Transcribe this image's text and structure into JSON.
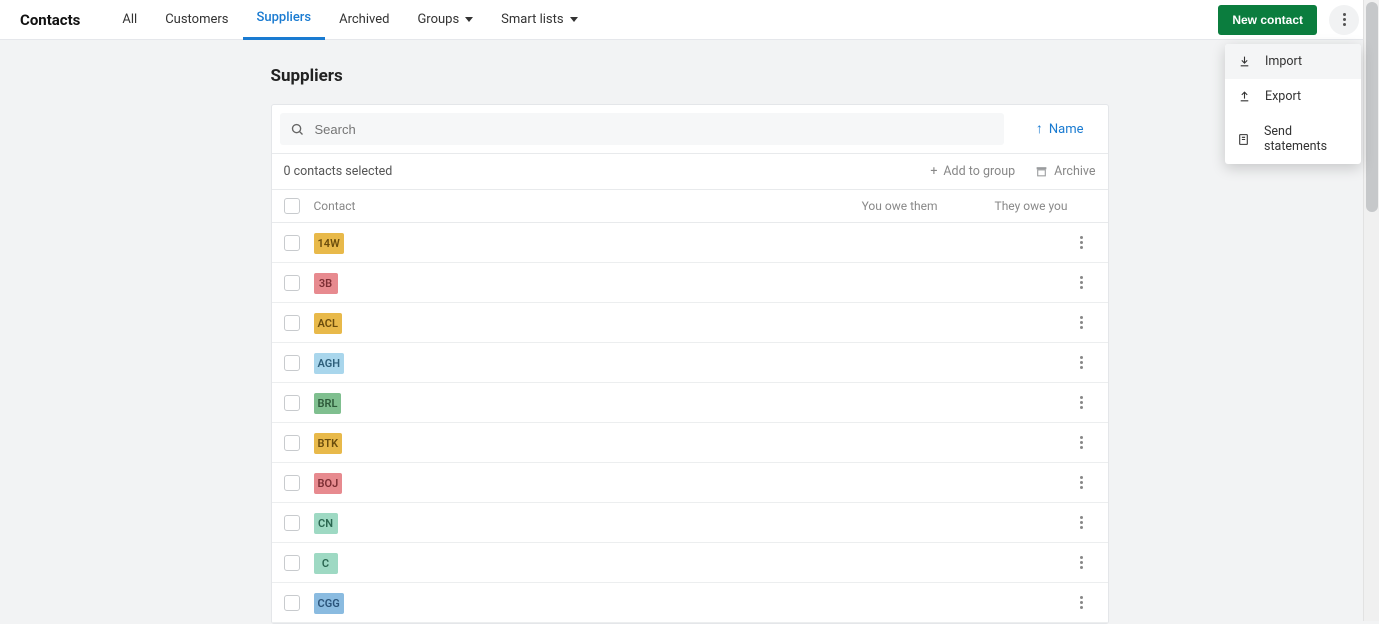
{
  "nav": {
    "title": "Contacts",
    "tabs": [
      {
        "label": "All",
        "active": false,
        "dropdown": false
      },
      {
        "label": "Customers",
        "active": false,
        "dropdown": false
      },
      {
        "label": "Suppliers",
        "active": true,
        "dropdown": false
      },
      {
        "label": "Archived",
        "active": false,
        "dropdown": false
      },
      {
        "label": "Groups",
        "active": false,
        "dropdown": true
      },
      {
        "label": "Smart lists",
        "active": false,
        "dropdown": true
      }
    ],
    "new_contact_label": "New contact"
  },
  "dropdown": {
    "items": [
      {
        "label": "Import",
        "icon": "import-icon"
      },
      {
        "label": "Export",
        "icon": "export-icon"
      },
      {
        "label": "Send statements",
        "icon": "statement-icon"
      }
    ]
  },
  "page_title": "Suppliers",
  "search": {
    "placeholder": "Search"
  },
  "sort": {
    "label": "Name",
    "direction": "asc"
  },
  "selection_text": "0 contacts selected",
  "actions": {
    "add_to_group": "Add to group",
    "archive": "Archive"
  },
  "columns": {
    "contact": "Contact",
    "you_owe": "You owe them",
    "they_owe": "They owe you"
  },
  "rows": [
    {
      "badge": "14W",
      "bg": "#e8b94a",
      "fg": "#6b4d0d"
    },
    {
      "badge": "3B",
      "bg": "#e78a8f",
      "fg": "#7d2e34"
    },
    {
      "badge": "ACL",
      "bg": "#e8b94a",
      "fg": "#6b4d0d"
    },
    {
      "badge": "AGH",
      "bg": "#a9d6ec",
      "fg": "#2e5f7a"
    },
    {
      "badge": "BRL",
      "bg": "#7fbf8f",
      "fg": "#2d5a39"
    },
    {
      "badge": "BTK",
      "bg": "#e8b94a",
      "fg": "#6b4d0d"
    },
    {
      "badge": "BOJ",
      "bg": "#e78a8f",
      "fg": "#7d2e34"
    },
    {
      "badge": "CN",
      "bg": "#9ed9c3",
      "fg": "#2a6650"
    },
    {
      "badge": "C",
      "bg": "#9ed9c3",
      "fg": "#2a6650"
    },
    {
      "badge": "CGG",
      "bg": "#8abbe0",
      "fg": "#2b547a"
    }
  ]
}
